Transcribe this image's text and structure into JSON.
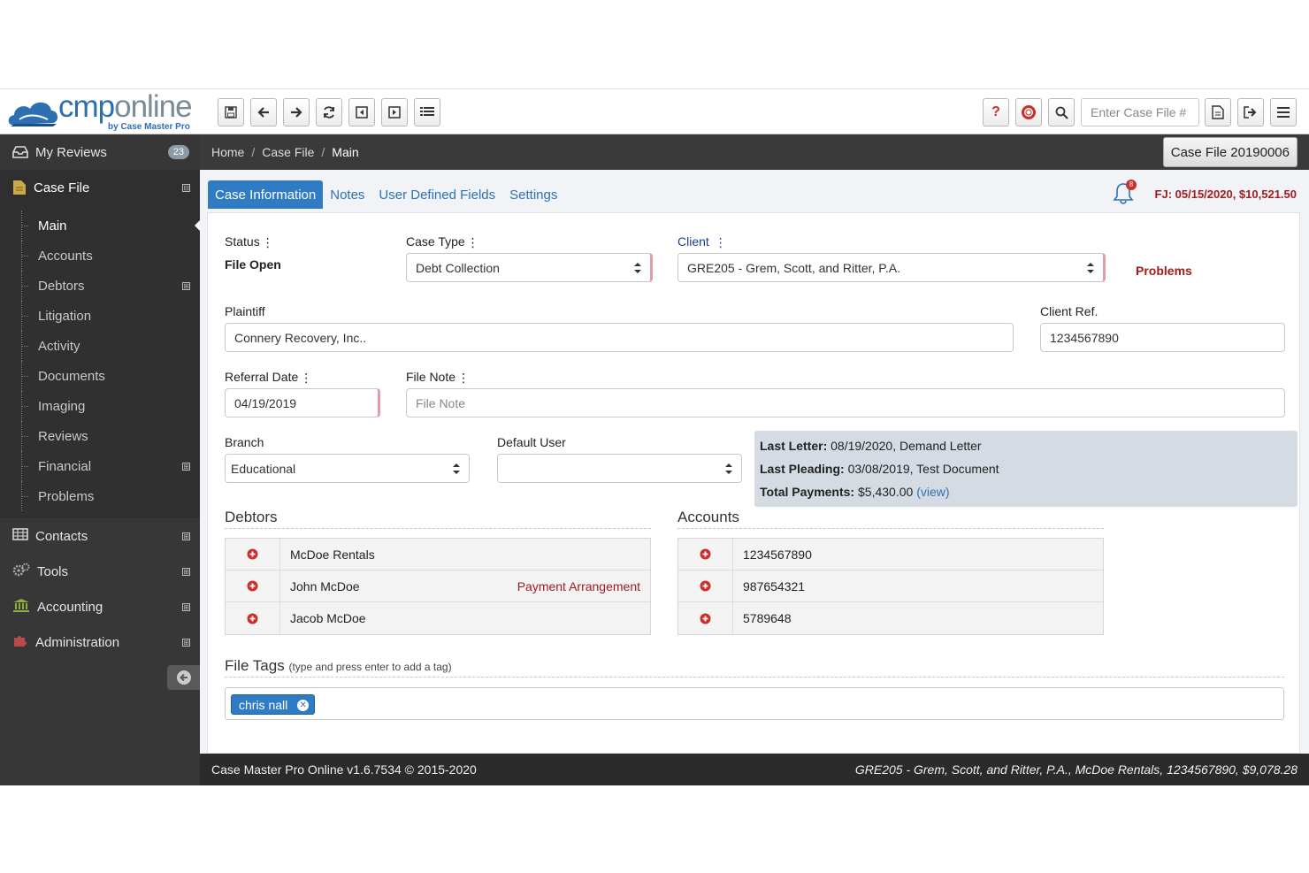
{
  "brand": {
    "name_a": "cmp",
    "name_b": "online",
    "tagline": "by Case Master Pro"
  },
  "toolbar": {
    "left_icons": [
      "save-icon",
      "arrow-left-icon",
      "arrow-right-icon",
      "refresh-icon",
      "step-back-icon",
      "step-forward-icon",
      "list-icon"
    ],
    "right_icons": [
      "help-icon",
      "lifebuoy-icon",
      "search-icon"
    ],
    "case_search_placeholder": "Enter Case File #",
    "after_icons": [
      "document-icon",
      "logout-icon",
      "menu-icon"
    ]
  },
  "sidebar": {
    "my_reviews": {
      "label": "My Reviews",
      "badge": "23"
    },
    "case_file": {
      "label": "Case File",
      "toggle": "⊟"
    },
    "sub_items": [
      {
        "label": "Main",
        "active": true,
        "expand": ""
      },
      {
        "label": "Accounts",
        "expand": ""
      },
      {
        "label": "Debtors",
        "expand": "⊞"
      },
      {
        "label": "Litigation",
        "expand": ""
      },
      {
        "label": "Activity",
        "expand": ""
      },
      {
        "label": "Documents",
        "expand": ""
      },
      {
        "label": "Imaging",
        "expand": ""
      },
      {
        "label": "Reviews",
        "expand": ""
      },
      {
        "label": "Financial",
        "expand": "⊞"
      },
      {
        "label": "Problems",
        "expand": ""
      }
    ],
    "sections": [
      {
        "label": "Contacts",
        "icon": "table-icon",
        "expand": "⊞"
      },
      {
        "label": "Tools",
        "icon": "gears-icon",
        "expand": "⊞"
      },
      {
        "label": "Accounting",
        "icon": "bank-icon",
        "expand": "⊞"
      },
      {
        "label": "Administration",
        "icon": "puzzle-icon",
        "expand": "⊞"
      }
    ]
  },
  "breadcrumb": {
    "home": "Home",
    "case_file": "Case File",
    "current": "Main",
    "sep": "/"
  },
  "case_label": "Case File 20190006",
  "tabs": [
    "Case Information",
    "Notes",
    "User Defined Fields",
    "Settings"
  ],
  "notifications": {
    "count": "8"
  },
  "fj": "FJ: 05/15/2020, $10,521.50",
  "form": {
    "status": {
      "label": "Status",
      "value": "File Open"
    },
    "case_type": {
      "label": "Case Type",
      "value": "Debt Collection"
    },
    "client": {
      "label": "Client",
      "value": "GRE205 - Grem, Scott, and Ritter, P.A."
    },
    "problems_link": "Problems",
    "plaintiff": {
      "label": "Plaintiff",
      "value": "Connery Recovery, Inc.."
    },
    "client_ref": {
      "label": "Client Ref.",
      "value": "1234567890"
    },
    "referral_date": {
      "label": "Referral Date",
      "value": "04/19/2019"
    },
    "file_note": {
      "label": "File Note",
      "placeholder": "File Note",
      "value": ""
    },
    "branch": {
      "label": "Branch",
      "value": "Educational"
    },
    "default_user": {
      "label": "Default User",
      "value": ""
    }
  },
  "info": {
    "last_letter_label": "Last Letter:",
    "last_letter": "08/19/2020, Demand Letter",
    "last_pleading_label": "Last Pleading:",
    "last_pleading": "03/08/2019, Test Document",
    "total_payments_label": "Total Payments:",
    "total_payments": "$5,430.00",
    "view": "(view)"
  },
  "debtors": {
    "title": "Debtors",
    "rows": [
      {
        "name": "McDoe Rentals",
        "note": ""
      },
      {
        "name": "John McDoe",
        "note": "Payment Arrangement"
      },
      {
        "name": "Jacob McDoe",
        "note": ""
      }
    ]
  },
  "accounts": {
    "title": "Accounts",
    "rows": [
      {
        "number": "1234567890"
      },
      {
        "number": "987654321"
      },
      {
        "number": "5789648"
      }
    ]
  },
  "file_tags": {
    "title": "File Tags",
    "hint": "(type and press enter to add a tag)",
    "tags": [
      "chris nall"
    ]
  },
  "footer": {
    "left": "Case Master Pro Online v1.6.7534 © 2015-2020",
    "right": "GRE205 - Grem, Scott, and Ritter, P.A., McDoe Rentals, 1234567890, $9,078.28"
  },
  "colors": {
    "accent": "#2f7bc4",
    "alert": "#a11c1c",
    "sidebar": "#373737",
    "required": "#e79aa3"
  }
}
